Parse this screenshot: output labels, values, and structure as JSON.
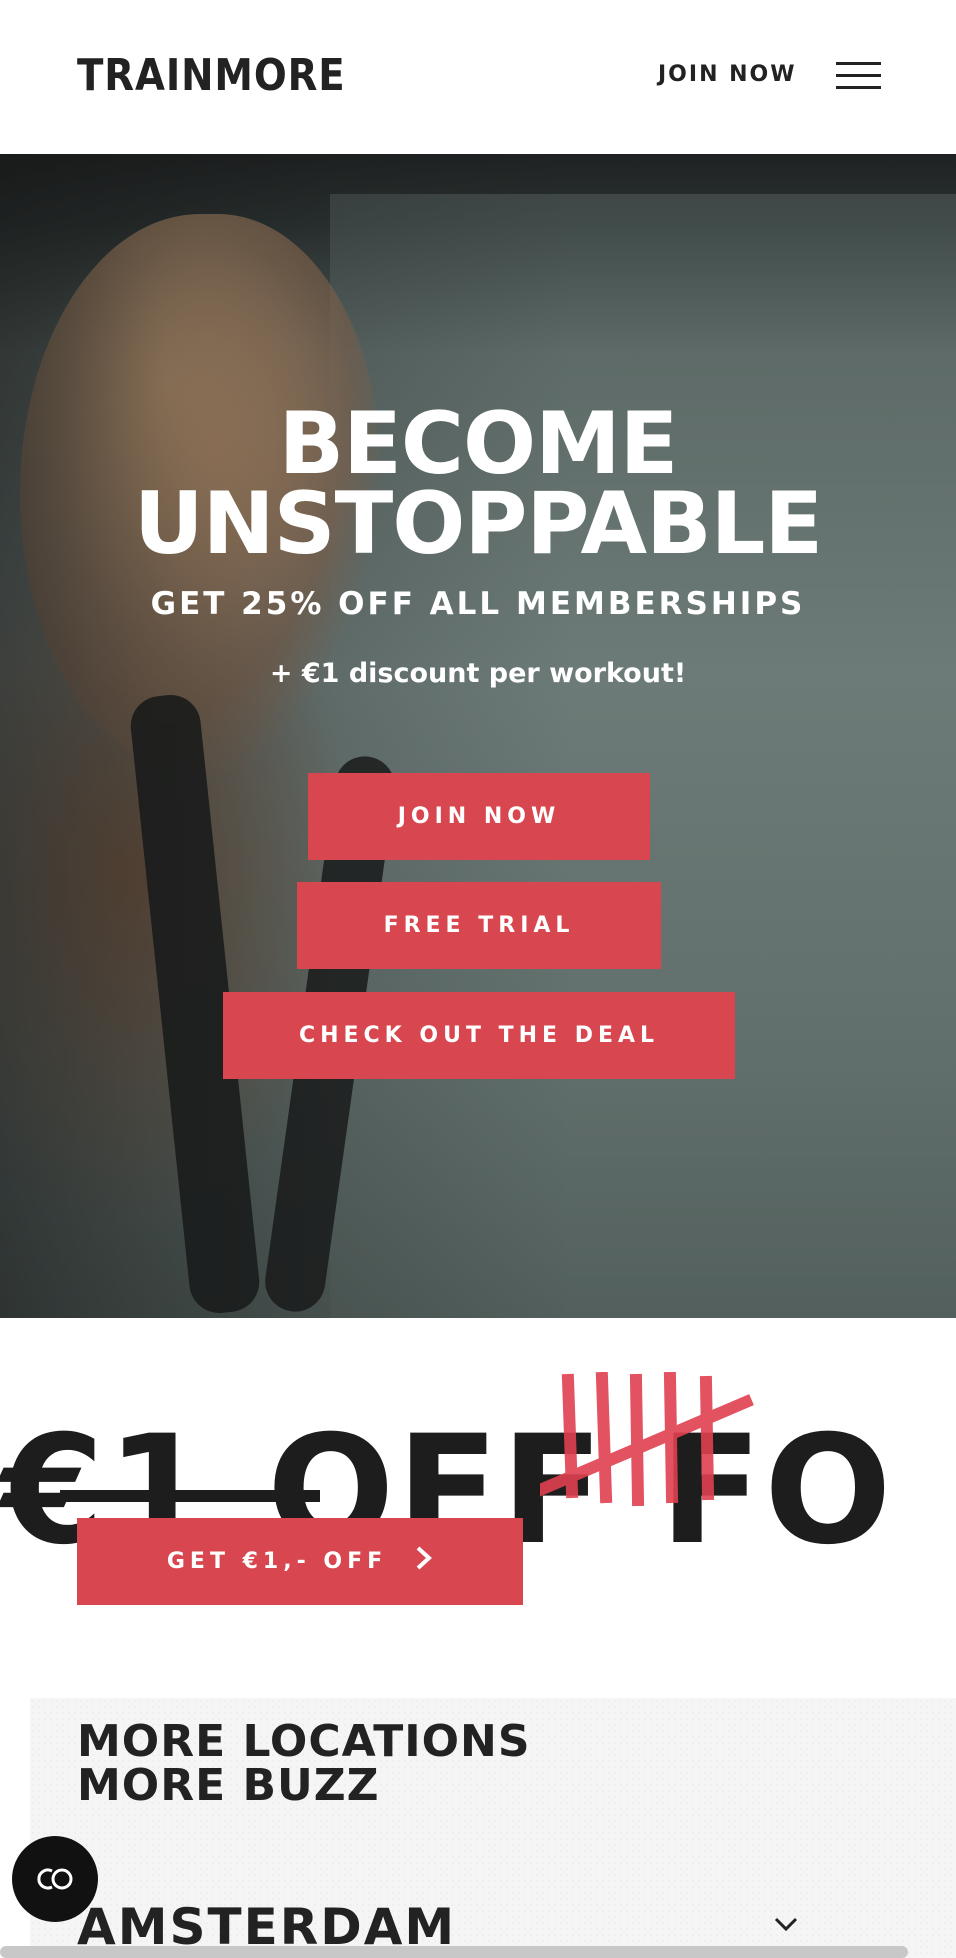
{
  "header": {
    "logo": "TRAINMORE",
    "join_label": "JOIN NOW",
    "menu_icon": "hamburger-menu-icon"
  },
  "hero": {
    "title_line1": "BECOME",
    "title_line2": "UNSTOPPABLE",
    "subtitle": "GET 25% OFF ALL MEMBERSHIPS",
    "small": "+ €1 discount per workout!",
    "buttons": {
      "join": "JOIN NOW",
      "trial": "FREE TRIAL",
      "deal": "CHECK OUT THE DEAL"
    }
  },
  "promo": {
    "marquee": "€1 OFF FO",
    "button": "GET €1,- OFF",
    "button_icon": "chevron-right-icon"
  },
  "locations": {
    "title_line1": "MORE LOCATIONS",
    "title_line2": "MORE BUZZ",
    "city": "AMSTERDAM",
    "city_icon": "chevron-down-icon"
  },
  "cookie": {
    "icon": "cookie-consent-icon"
  },
  "colors": {
    "accent": "#d84750",
    "text": "#222222",
    "tally": "#e0404f"
  }
}
